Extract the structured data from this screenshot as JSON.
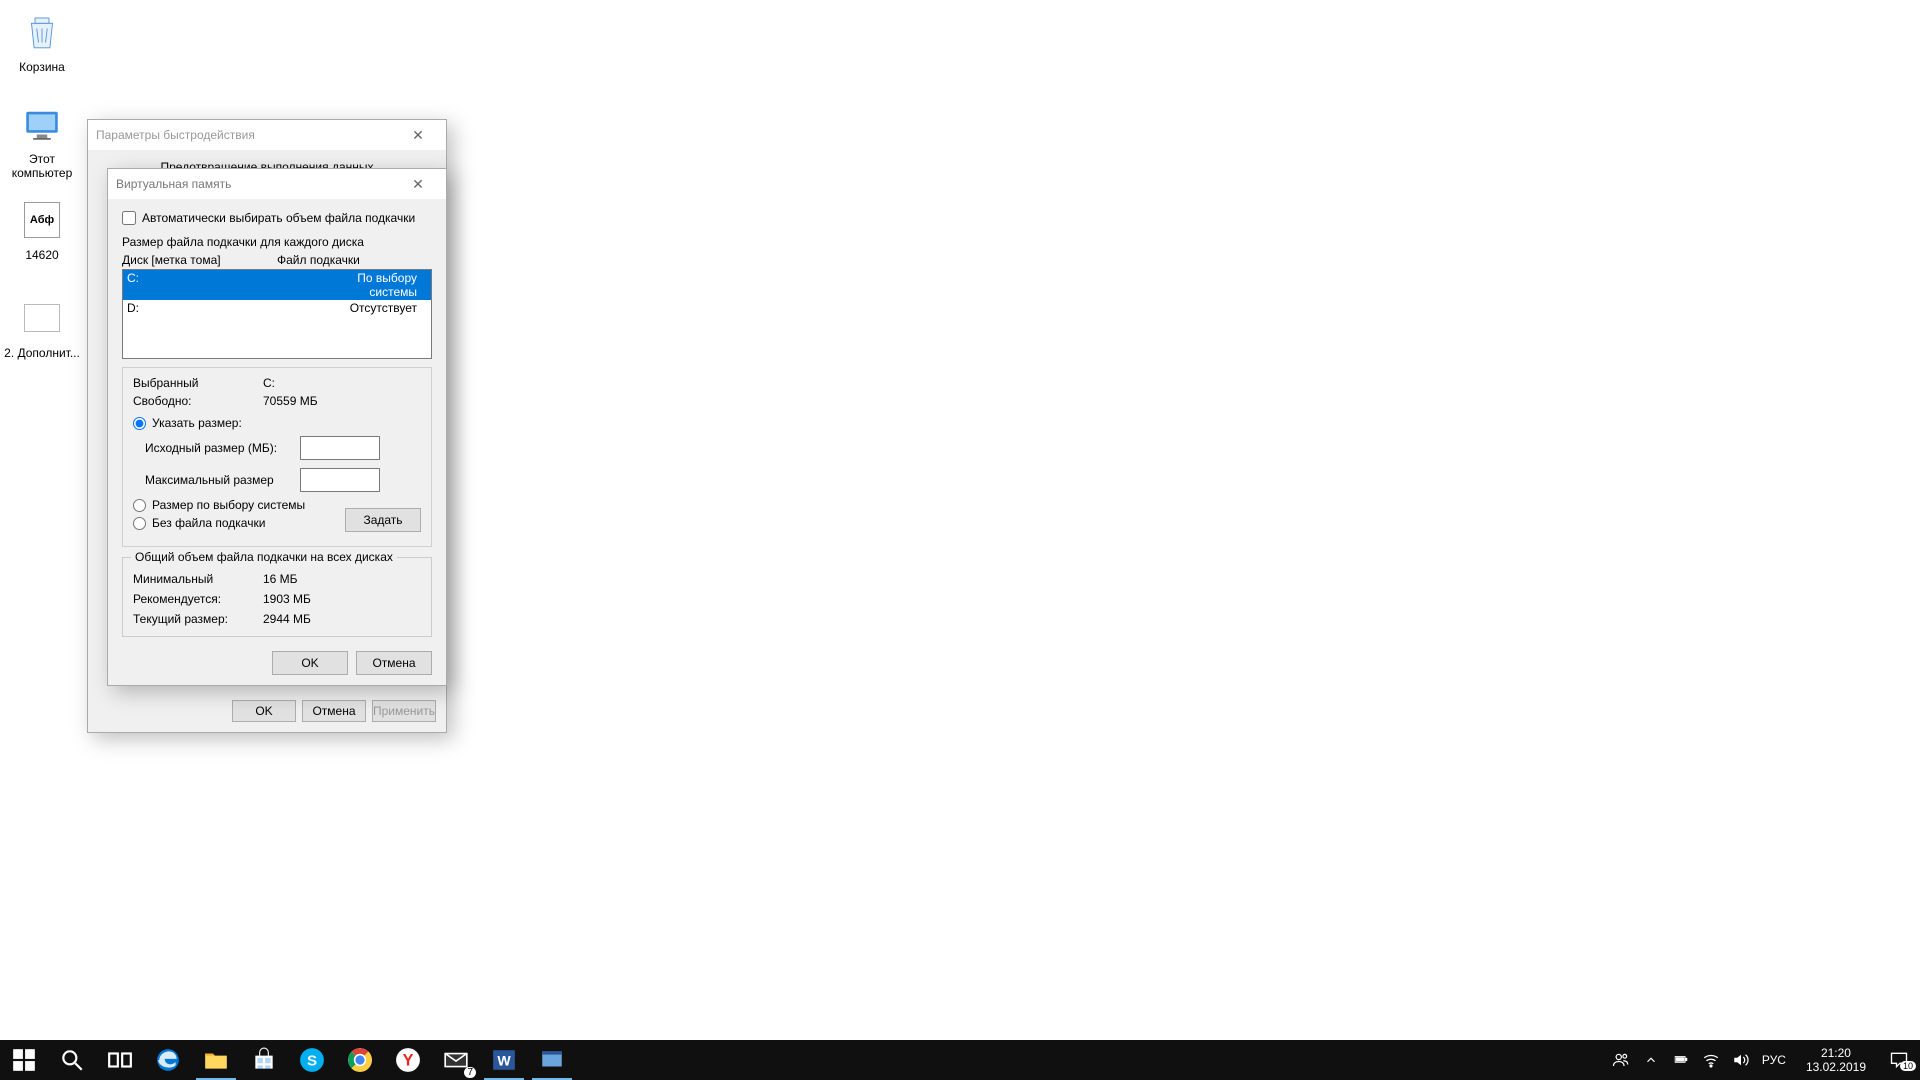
{
  "desktop": {
    "icons": [
      {
        "name": "Корзина"
      },
      {
        "name": "Этот компьютер"
      },
      {
        "name": "14620"
      },
      {
        "name": "2. Дополнит..."
      }
    ]
  },
  "perfDialog": {
    "title": "Параметры быстродействия",
    "tab": "Предотвращение выполнения данных",
    "ok": "OK",
    "cancel": "Отмена",
    "apply": "Применить"
  },
  "vmDialog": {
    "title": "Виртуальная память",
    "autoCheckbox": "Автоматически выбирать объем файла подкачки",
    "sizeLabel": "Размер файла подкачки для каждого диска",
    "colDrive": "Диск [метка тома]",
    "colPage": "Файл подкачки",
    "rows": [
      {
        "drive": "C:",
        "page": "По выбору системы",
        "selected": true
      },
      {
        "drive": "D:",
        "page": "Отсутствует",
        "selected": false
      }
    ],
    "selectedLabel": "Выбранный",
    "selectedDrive": "C:",
    "freeLabel": "Свободно:",
    "freeValue": "70559 МБ",
    "radioCustom": "Указать размер:",
    "initLabel": "Исходный размер (МБ):",
    "maxLabel": "Максимальный размер",
    "radioSystem": "Размер по выбору системы",
    "radioNone": "Без файла подкачки",
    "setBtn": "Задать",
    "totalTitle": "Общий объем файла подкачки на всех дисках",
    "minLabel": "Минимальный",
    "minValue": "16 МБ",
    "recLabel": "Рекомендуется:",
    "recValue": "1903 МБ",
    "curLabel": "Текущий размер:",
    "curValue": "2944 МБ",
    "ok": "OK",
    "cancel": "Отмена"
  },
  "taskbar": {
    "lang": "РУС",
    "time": "21:20",
    "date": "13.02.2019",
    "notif_count": "10",
    "mail_badge": "7"
  }
}
